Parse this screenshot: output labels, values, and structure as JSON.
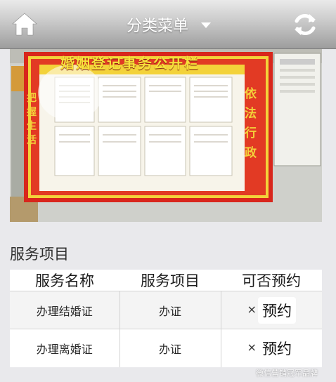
{
  "header": {
    "menu_title": "分类菜单",
    "home_icon": "home-icon",
    "refresh_icon": "refresh-icon",
    "dropdown_icon": "chevron-down-icon"
  },
  "banner": {
    "board_title": "婚姻登记事务公开栏",
    "couplet_left": "把握生活",
    "couplet_right": "依法行政"
  },
  "services": {
    "section_title": "服务项目",
    "columns": [
      "服务名称",
      "服务项目",
      "可否预约"
    ],
    "rows": [
      {
        "name": "办理结婚证",
        "item": "办证",
        "bookable": "×",
        "action": "预约"
      },
      {
        "name": "办理离婚证",
        "item": "办证",
        "bookable": "×",
        "action": "预约"
      }
    ]
  },
  "watermark": "微信营销冠军品牌",
  "colors": {
    "board_red": "#d8261c",
    "board_gold": "#f3d23a"
  }
}
